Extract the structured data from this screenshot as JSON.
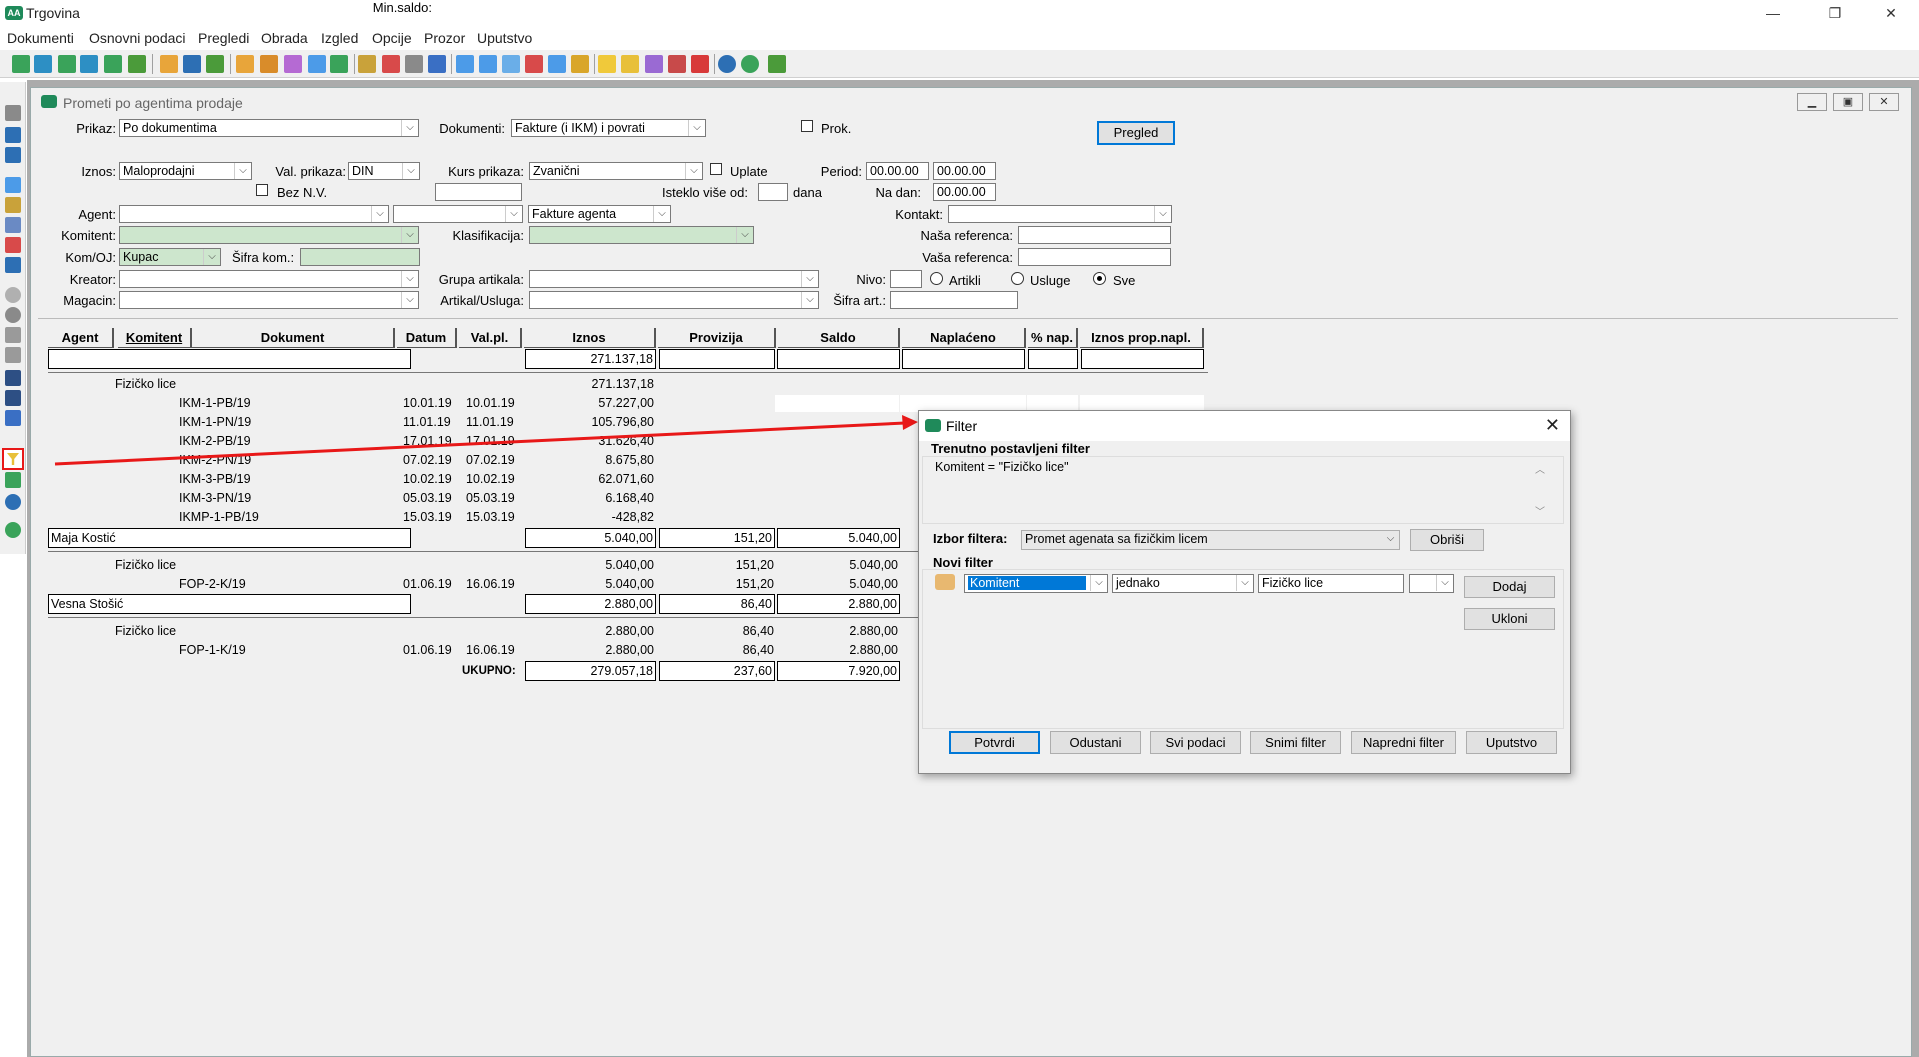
{
  "app": {
    "title": "Trgovina",
    "logo_text": "AA"
  },
  "menu": [
    "Dokumenti",
    "Osnovni podaci",
    "Pregledi",
    "Obrada",
    "Izgled",
    "Opcije",
    "Prozor",
    "Uputstvo"
  ],
  "window_controls": {
    "minimize": "—",
    "restore": "❐",
    "close": "✕"
  },
  "child": {
    "title": "Prometi po agentima prodaje"
  },
  "form": {
    "prikaz_label": "Prikaz:",
    "prikaz_value": "Po dokumentima",
    "dokumenti_label": "Dokumenti:",
    "dokumenti_value": "Fakture (i IKM) i povrati",
    "prok_label": "Prok.",
    "pregled_button": "Pregled",
    "iznos_label": "Iznos:",
    "iznos_value": "Maloprodajni",
    "val_prikaza_label": "Val. prikaza:",
    "val_prikaza_value": "DIN",
    "kurs_prikaza_label": "Kurs prikaza:",
    "kurs_prikaza_value": "Zvanični",
    "uplate_label": "Uplate",
    "period_label": "Period:",
    "period_from": "00.00.00",
    "period_to": "00.00.00",
    "bez_nv_label": "Bez N.V.",
    "min_saldo_label": "Min.saldo:",
    "min_saldo_value": "",
    "isteklo_label": "Isteklo više od:",
    "isteklo_value": "",
    "dana_label": "dana",
    "na_dan_label": "Na dan:",
    "na_dan_value": "00.00.00",
    "agent_label": "Agent:",
    "agent_value": "",
    "agent2_value": "",
    "fakture_agenta_value": "Fakture agenta",
    "kontakt_label": "Kontakt:",
    "kontakt_value": "",
    "komitent_label": "Komitent:",
    "komitent_value": "",
    "klasifikacija_label": "Klasifikacija:",
    "klasifikacija_value": "",
    "nasa_ref_label": "Naša referenca:",
    "nasa_ref_value": "",
    "kom_oj_label": "Kom/OJ:",
    "kom_oj_value": "Kupac",
    "sifra_kom_label": "Šifra kom.:",
    "sifra_kom_value": "",
    "vasa_ref_label": "Vaša referenca:",
    "vasa_ref_value": "",
    "kreator_label": "Kreator:",
    "kreator_value": "",
    "grupa_label": "Grupa artikala:",
    "grupa_value": "",
    "nivo_label": "Nivo:",
    "nivo_value": "",
    "artikli_label": "Artikli",
    "usluge_label": "Usluge",
    "sve_label": "Sve",
    "magacin_label": "Magacin:",
    "magacin_value": "",
    "artikal_label": "Artikal/Usluga:",
    "artikal_value": "",
    "sifra_art_label": "Šifra art.:",
    "sifra_art_value": ""
  },
  "grid": {
    "headers": [
      "Agent",
      "Komitent",
      "Dokument",
      "Datum",
      "Val.pl.",
      "Iznos",
      "Provizija",
      "Saldo",
      "Naplaćeno",
      "% nap.",
      "Iznos prop.napl."
    ],
    "total_top": "271.137,18",
    "rows": [
      {
        "indent": 1,
        "text": "Fizičko lice",
        "iznos": "271.137,18"
      },
      {
        "indent": 2,
        "text": "IKM-1-PB/19",
        "datum": "10.01.19",
        "valpl": "10.01.19",
        "iznos": "57.227,00"
      },
      {
        "indent": 2,
        "text": "IKM-1-PN/19",
        "datum": "11.01.19",
        "valpl": "11.01.19",
        "iznos": "105.796,80"
      },
      {
        "indent": 2,
        "text": "IKM-2-PB/19",
        "datum": "17.01.19",
        "valpl": "17.01.19",
        "iznos": "31.626,40"
      },
      {
        "indent": 2,
        "text": "IKM-2-PN/19",
        "datum": "07.02.19",
        "valpl": "07.02.19",
        "iznos": "8.675,80"
      },
      {
        "indent": 2,
        "text": "IKM-3-PB/19",
        "datum": "10.02.19",
        "valpl": "10.02.19",
        "iznos": "62.071,60"
      },
      {
        "indent": 2,
        "text": "IKM-3-PN/19",
        "datum": "05.03.19",
        "valpl": "05.03.19",
        "iznos": "6.168,40"
      },
      {
        "indent": 2,
        "text": "IKMP-1-PB/19",
        "datum": "15.03.19",
        "valpl": "15.03.19",
        "iznos": "-428,82"
      }
    ],
    "agent1": {
      "name": "Maja Kostić",
      "iznos": "5.040,00",
      "provizija": "151,20",
      "saldo": "5.040,00"
    },
    "agent1_rows": [
      {
        "indent": 1,
        "text": "Fizičko lice",
        "iznos": "5.040,00",
        "provizija": "151,20",
        "saldo": "5.040,00"
      },
      {
        "indent": 2,
        "text": "FOP-2-K/19",
        "datum": "01.06.19",
        "valpl": "16.06.19",
        "iznos": "5.040,00",
        "provizija": "151,20",
        "saldo": "5.040,00"
      }
    ],
    "agent2": {
      "name": "Vesna Stošić",
      "iznos": "2.880,00",
      "provizija": "86,40",
      "saldo": "2.880,00"
    },
    "agent2_rows": [
      {
        "indent": 1,
        "text": "Fizičko lice",
        "iznos": "2.880,00",
        "provizija": "86,40",
        "saldo": "2.880,00"
      },
      {
        "indent": 2,
        "text": "FOP-1-K/19",
        "datum": "01.06.19",
        "valpl": "16.06.19",
        "iznos": "2.880,00",
        "provizija": "86,40",
        "saldo": "2.880,00"
      }
    ],
    "total_label": "UKUPNO:",
    "total_iznos": "279.057,18",
    "total_provizija": "237,60",
    "total_saldo": "7.920,00"
  },
  "filter_dialog": {
    "title": "Filter",
    "current_label": "Trenutno postavljeni filter",
    "current_value": "Komitent = \"Fizičko lice\"",
    "izbor_label": "Izbor filtera:",
    "izbor_value": "Promet agenata sa fizičkim licem",
    "obrisi_button": "Obriši",
    "novi_label": "Novi filter",
    "field_value": "Komitent",
    "operator_value": "jednako",
    "value_value": "Fizičko lice",
    "dodaj_button": "Dodaj",
    "ukloni_button": "Ukloni",
    "buttons": [
      "Potvrdi",
      "Odustani",
      "Svi podaci",
      "Snimi filter",
      "Napredni filter",
      "Uputstvo"
    ]
  },
  "colors": {
    "arrow": "#e81818",
    "highlight": "#e81818",
    "selection": "#0078d7",
    "green_field": "#cde6cd",
    "brand": "#1f8a5a"
  }
}
